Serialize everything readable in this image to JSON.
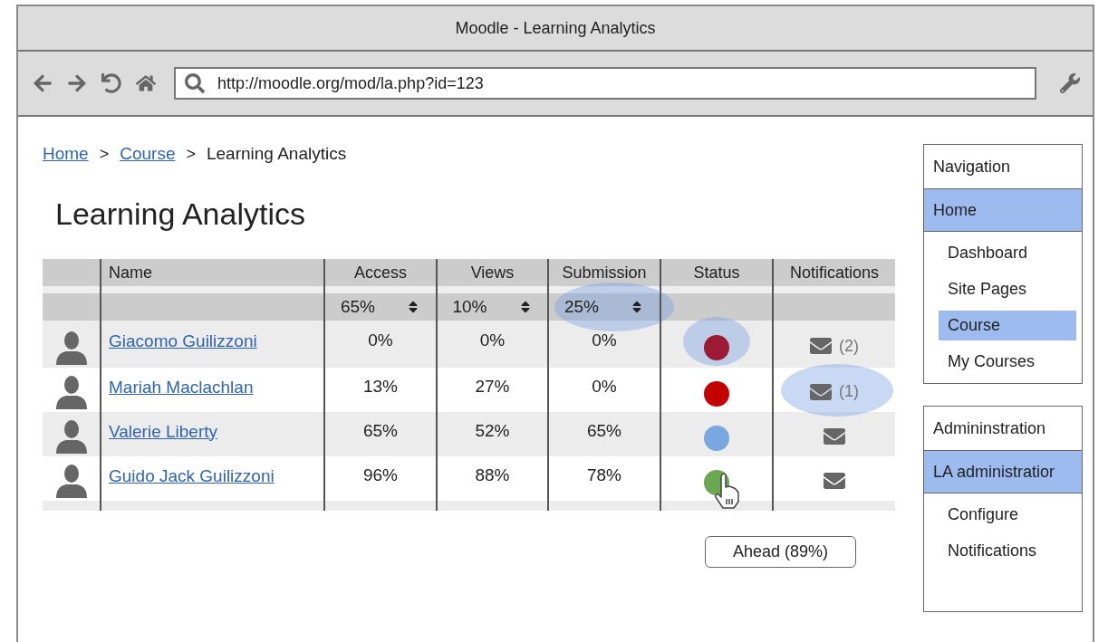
{
  "window": {
    "title": "Moodle - Learning Analytics"
  },
  "address_bar": {
    "value": "http://moodle.org/mod/la.php?id=123"
  },
  "breadcrumb": {
    "separator": ">",
    "items": [
      {
        "label": "Home",
        "link": true
      },
      {
        "label": "Course",
        "link": true
      },
      {
        "label": "Learning Analytics",
        "link": false
      }
    ]
  },
  "heading": "Learning Analytics",
  "table": {
    "columns": [
      "Name",
      "Access",
      "Views",
      "Submission",
      "Status",
      "Notifications"
    ],
    "filters": [
      {
        "value": "65%",
        "highlighted": false
      },
      {
        "value": "10%",
        "highlighted": false
      },
      {
        "value": "25%",
        "highlighted": true
      }
    ],
    "rows": [
      {
        "name": "Giacomo Guilizzoni",
        "access": "0%",
        "views": "0%",
        "submission": "0%",
        "color": "#9b1b35",
        "status_highlighted": true,
        "notification_count": "(2)",
        "notification_highlighted": false
      },
      {
        "name": "Mariah Maclachlan",
        "access": "13%",
        "views": "27%",
        "submission": "0%",
        "color": "#c40000",
        "status_highlighted": false,
        "notification_count": "(1)",
        "notification_highlighted": true
      },
      {
        "name": "Valerie Liberty",
        "access": "65%",
        "views": "52%",
        "submission": "65%",
        "color": "#7aa7e0",
        "status_highlighted": false,
        "notification_highlighted": false
      },
      {
        "name": "Guido Jack Guilizzoni",
        "access": "96%",
        "views": "88%",
        "submission": "78%",
        "color": "#6aa84f",
        "status_highlighted": false,
        "notification_highlighted": false,
        "tooltip": "Ahead (89%)"
      }
    ]
  },
  "sidebar": {
    "blocks": [
      {
        "title": "Navigation",
        "items": [
          {
            "label": "Home",
            "selected": true,
            "children": [
              {
                "label": "Dashboard",
                "selected": false
              },
              {
                "label": "Site Pages",
                "selected": false
              },
              {
                "label": "Course",
                "selected": true
              },
              {
                "label": "My Courses",
                "selected": false
              }
            ]
          }
        ]
      },
      {
        "title": "Admininstration",
        "items": [
          {
            "label": "LA administratior",
            "selected": true,
            "children": [
              {
                "label": "Configure",
                "selected": false
              },
              {
                "label": "Notifications",
                "selected": false
              }
            ]
          }
        ]
      }
    ]
  }
}
